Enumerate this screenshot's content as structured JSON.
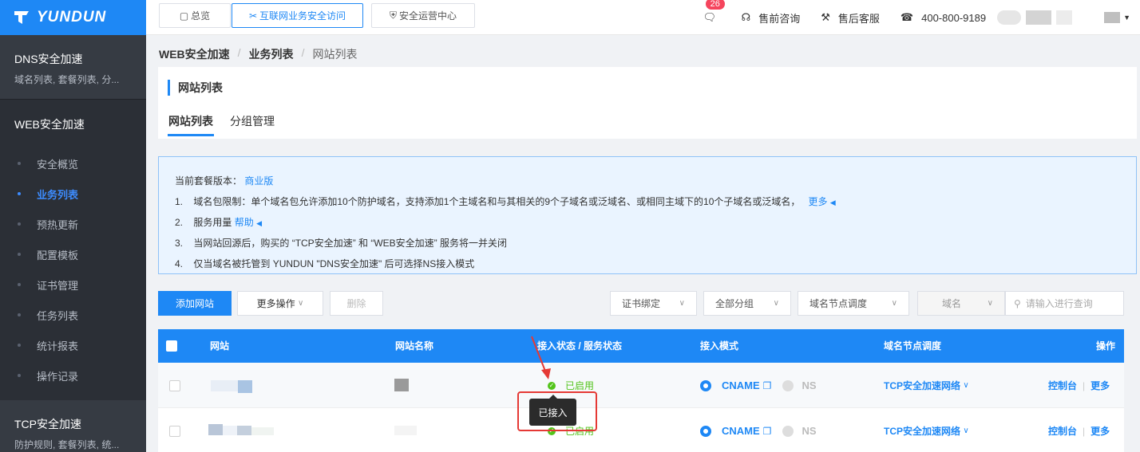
{
  "sidebar": {
    "logo": "YUNDUN",
    "sections": [
      {
        "title": "DNS安全加速",
        "sub": "域名列表, 套餐列表, 分..."
      },
      {
        "title": "WEB安全加速"
      },
      {
        "title": "TCP安全加速",
        "sub": "防护规则, 套餐列表, 统..."
      }
    ],
    "items": [
      {
        "label": "安全概览"
      },
      {
        "label": "业务列表"
      },
      {
        "label": "预热更新"
      },
      {
        "label": "配置模板"
      },
      {
        "label": "证书管理"
      },
      {
        "label": "任务列表"
      },
      {
        "label": "统计报表"
      },
      {
        "label": "操作记录"
      }
    ]
  },
  "topbar": {
    "tabs": [
      {
        "label": "总览"
      },
      {
        "label": "互联网业务安全访问"
      },
      {
        "label": "安全运营中心"
      }
    ],
    "badge": "26",
    "consult": "售前咨询",
    "service": "售后客服",
    "phone": "400-800-9189"
  },
  "breadcrumb": [
    "WEB安全加速",
    "业务列表",
    "网站列表"
  ],
  "card": {
    "title": "网站列表",
    "tabs": [
      "网站列表",
      "分组管理"
    ]
  },
  "notice": {
    "plan_label": "当前套餐版本：",
    "plan_value": "商业版",
    "items": [
      {
        "n": "1.",
        "text": "域名包限制：单个域名包允许添加10个防护域名，支持添加1个主域名和与其相关的9个子域名或泛域名、或相同主域下的10个子域名或泛域名，",
        "link": "更多"
      },
      {
        "n": "2.",
        "text": "服务用量",
        "link": "帮助"
      },
      {
        "n": "3.",
        "text": "当网站回源后，购买的 “TCP安全加速” 和 “WEB安全加速” 服务将一并关闭"
      },
      {
        "n": "4.",
        "text": "仅当域名被托管到 YUNDUN \"DNS安全加速\" 后可选择NS接入模式"
      }
    ]
  },
  "toolbar": {
    "add": "添加网站",
    "more": "更多操作",
    "delete": "删除",
    "filters": [
      "证书绑定",
      "全部分组",
      "域名节点调度",
      "域名"
    ],
    "search_placeholder": "请输入进行查询"
  },
  "table": {
    "headers": [
      "网站",
      "网站名称",
      "接入状态 / 服务状态",
      "接入模式",
      "域名节点调度",
      "操作"
    ],
    "rows": [
      {
        "status": "已启用",
        "mode_on": "CNAME",
        "mode_off": "NS",
        "sched": "TCP安全加速网络",
        "op1": "控制台",
        "op2": "更多"
      },
      {
        "status": "已启用",
        "mode_on": "CNAME",
        "mode_off": "NS",
        "sched": "TCP安全加速网络",
        "op1": "控制台",
        "op2": "更多"
      }
    ]
  },
  "tooltip": "已接入",
  "colors": {
    "primary": "#1e88f5",
    "sidebar": "#2b2f36",
    "success": "#52c41a",
    "annotation": "#e53935"
  }
}
